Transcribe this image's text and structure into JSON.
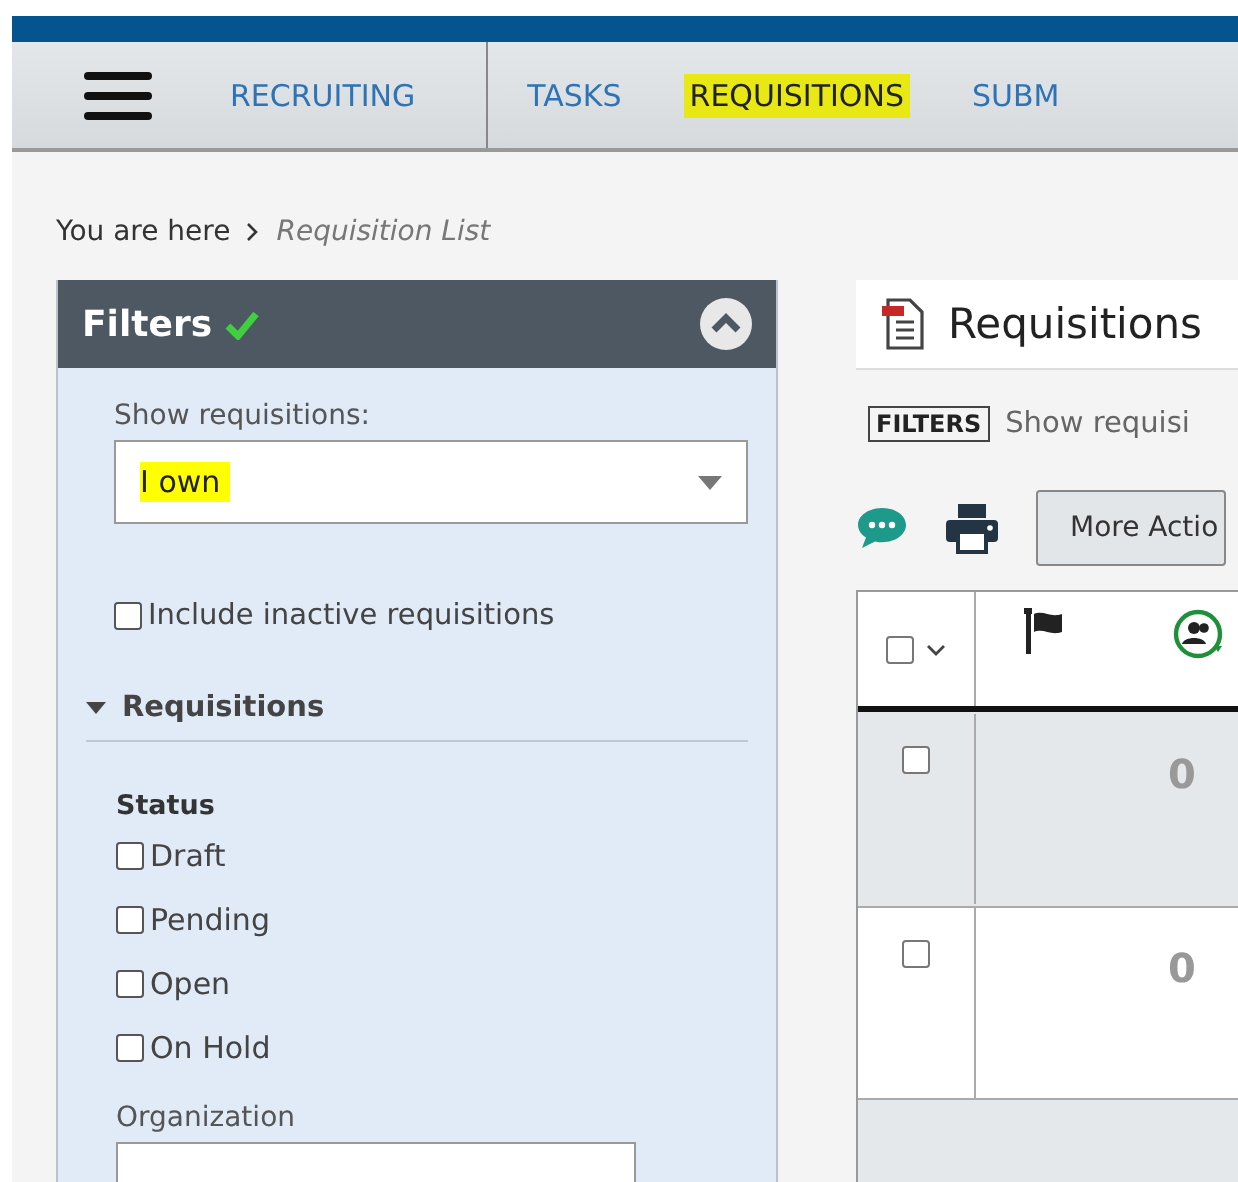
{
  "nav": {
    "items": [
      {
        "label": "RECRUITING",
        "selected": false
      },
      {
        "label": "TASKS",
        "selected": false
      },
      {
        "label": "REQUISITIONS",
        "selected": true
      },
      {
        "label": "SUBM",
        "selected": false
      }
    ]
  },
  "breadcrumb": {
    "prefix": "You are here",
    "current": "Requisition List"
  },
  "filters": {
    "title": "Filters",
    "expanded": true,
    "show_label": "Show requisitions:",
    "show_value": "I own",
    "include_inactive": {
      "label": "Include inactive requisitions",
      "checked": false
    },
    "section": {
      "title": "Requisitions",
      "expanded": true,
      "status_label": "Status",
      "statuses": [
        {
          "label": "Draft",
          "checked": false
        },
        {
          "label": "Pending",
          "checked": false
        },
        {
          "label": "Open",
          "checked": false
        },
        {
          "label": "On Hold",
          "checked": false
        }
      ],
      "organization_label": "Organization"
    }
  },
  "main": {
    "title": "Requisitions",
    "filters_tag": "FILTERS",
    "filters_summary": "Show requisi",
    "more_actions": "More Actio",
    "table": {
      "header_checked": false,
      "rows": [
        {
          "checked": false,
          "highlighted": true,
          "count": "0"
        },
        {
          "checked": false,
          "highlighted": false,
          "count": "0"
        }
      ]
    }
  }
}
